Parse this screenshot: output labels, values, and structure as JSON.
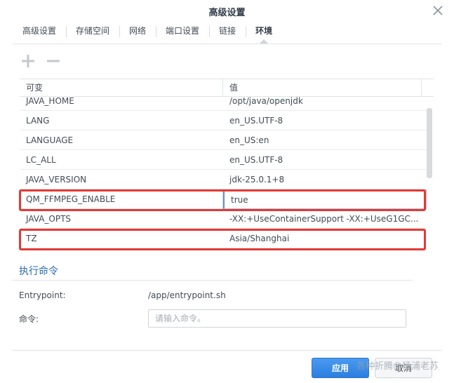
{
  "window": {
    "title": "高级设置"
  },
  "tabs": [
    {
      "label": "高级设置"
    },
    {
      "label": "存储空间"
    },
    {
      "label": "网络"
    },
    {
      "label": "端口设置"
    },
    {
      "label": "链接"
    },
    {
      "label": "环境",
      "active": true
    }
  ],
  "grid": {
    "columns": [
      "可变",
      "值"
    ],
    "rows": [
      {
        "name": "JAVA_HOME",
        "value": "/opt/java/openjdk"
      },
      {
        "name": "LANG",
        "value": "en_US.UTF-8"
      },
      {
        "name": "LANGUAGE",
        "value": "en_US:en"
      },
      {
        "name": "LC_ALL",
        "value": "en_US.UTF-8"
      },
      {
        "name": "JAVA_VERSION",
        "value": "jdk-25.0.1+8"
      },
      {
        "name": "QM_FFMPEG_ENABLE",
        "value": "true",
        "editing": true,
        "highlighted": true
      },
      {
        "name": "JAVA_OPTS",
        "value": "-XX:+UseContainerSupport -XX:+UseG1GC..."
      },
      {
        "name": "TZ",
        "value": "Asia/Shanghai",
        "highlighted": true
      }
    ]
  },
  "exec": {
    "section_title": "执行命令",
    "entrypoint_label": "Entrypoint:",
    "entrypoint_value": "/app/entrypoint.sh",
    "command_label": "命令:",
    "command_placeholder": "请输入命令。",
    "command_value": ""
  },
  "footer": {
    "apply_label": "应用",
    "cancel_label": "取消",
    "watermark": "各种折腾@杨浦老苏"
  },
  "colors": {
    "accent": "#2a6aa8",
    "highlight": "#e53935",
    "primary_button": "#2b7fe0"
  }
}
